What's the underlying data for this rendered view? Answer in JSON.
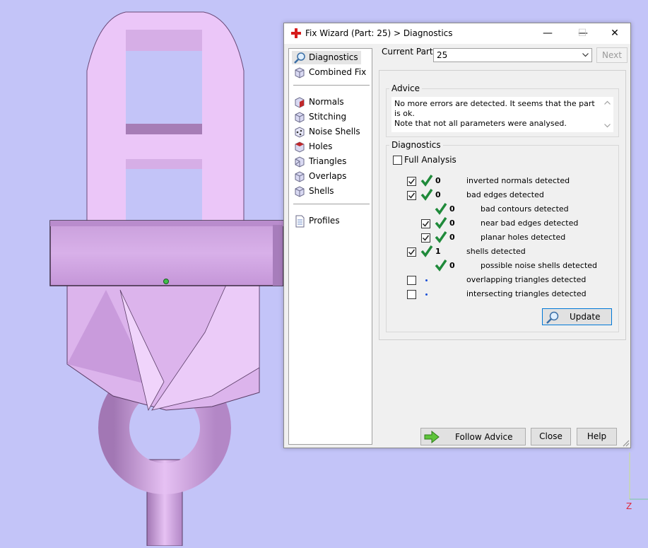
{
  "window": {
    "title": "Fix Wizard (Part: 25) > Diagnostics",
    "minimize_glyph": "—",
    "maximize_glyph": "☐",
    "close_glyph": "✕"
  },
  "sidebar": {
    "items": [
      {
        "label": "Diagnostics",
        "icon": "magnifier-icon"
      },
      {
        "label": "Combined Fix",
        "icon": "cube-icon"
      },
      {
        "label": "Normals",
        "icon": "normals-cube-icon"
      },
      {
        "label": "Stitching",
        "icon": "stitching-cube-icon"
      },
      {
        "label": "Noise Shells",
        "icon": "noise-shells-cube-icon"
      },
      {
        "label": "Holes",
        "icon": "holes-cube-icon"
      },
      {
        "label": "Triangles",
        "icon": "triangles-cube-icon"
      },
      {
        "label": "Overlaps",
        "icon": "overlaps-cube-icon"
      },
      {
        "label": "Shells",
        "icon": "shells-cube-icon"
      },
      {
        "label": "Profiles",
        "icon": "document-icon"
      }
    ]
  },
  "header": {
    "current_part_label": "Current Part:",
    "current_part_value": "25",
    "next_label": "Next"
  },
  "advice": {
    "title": "Advice",
    "text": "No more errors are detected. It seems that the part is ok.\nNote that not all parameters were analysed."
  },
  "diagnostics": {
    "title": "Diagnostics",
    "full_analysis_label": "Full Analysis",
    "full_analysis_checked": false,
    "rows": [
      {
        "checkbox": true,
        "checked": true,
        "status": "ok",
        "count": "0",
        "label": "inverted normals detected"
      },
      {
        "checkbox": true,
        "checked": true,
        "status": "ok",
        "count": "0",
        "label": "bad edges detected"
      },
      {
        "checkbox": false,
        "checked": false,
        "status": "ok",
        "count": "0",
        "label": "bad contours detected"
      },
      {
        "checkbox": true,
        "checked": true,
        "status": "ok",
        "count": "0",
        "label": "near bad edges detected"
      },
      {
        "checkbox": true,
        "checked": true,
        "status": "ok",
        "count": "0",
        "label": "planar holes detected"
      },
      {
        "checkbox": true,
        "checked": true,
        "status": "ok",
        "count": "1",
        "label": "shells detected"
      },
      {
        "checkbox": false,
        "checked": false,
        "status": "ok",
        "count": "0",
        "label": "possible noise shells detected"
      },
      {
        "checkbox": true,
        "checked": false,
        "status": "pending",
        "count": "",
        "label": "overlapping triangles detected"
      },
      {
        "checkbox": true,
        "checked": false,
        "status": "pending",
        "count": "",
        "label": "intersecting triangles detected"
      }
    ],
    "update_label": "Update"
  },
  "footer": {
    "follow_advice_label": "Follow Advice",
    "close_label": "Close",
    "help_label": "Help"
  },
  "viewport": {
    "axis_label": "Z"
  },
  "colors": {
    "background": "#c3c4f8",
    "model_fill": "#e8c2f5",
    "check_green": "#1f8a3a",
    "pending_dot": "#1a4fd6",
    "axis_red": "#e0283c"
  }
}
